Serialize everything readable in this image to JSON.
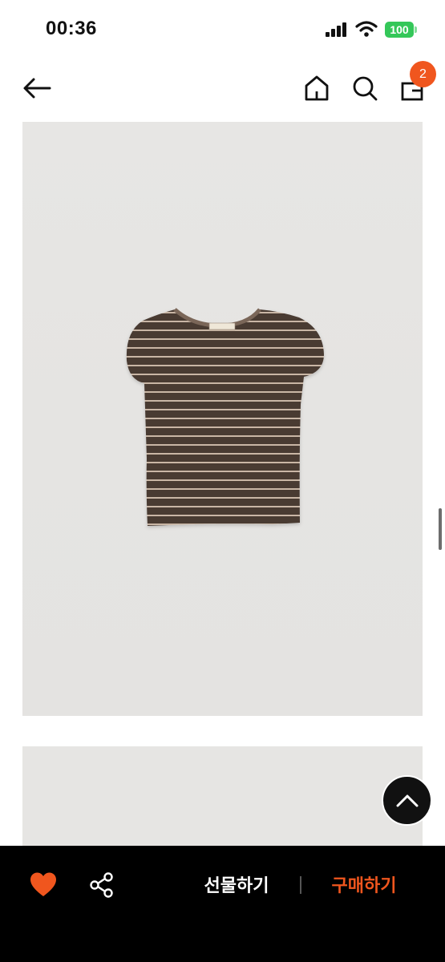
{
  "status_bar": {
    "time": "00:36",
    "battery": "100"
  },
  "nav": {
    "icons": [
      "back-arrow-icon",
      "home-icon",
      "search-icon",
      "cart-icon"
    ],
    "cart_count": "2"
  },
  "colors": {
    "accent": "#f0561e",
    "bottom_bar": "#000000",
    "battery": "#34c759"
  },
  "product_images": [
    {
      "subject": "brown striped cap-sleeve t-shirt"
    },
    {
      "subject": "product photo (partially visible)"
    }
  ],
  "bottom_bar": {
    "like_icon": "heart-icon",
    "share_icon": "share-icon",
    "gift_label": "선물하기",
    "buy_label": "구매하기"
  }
}
